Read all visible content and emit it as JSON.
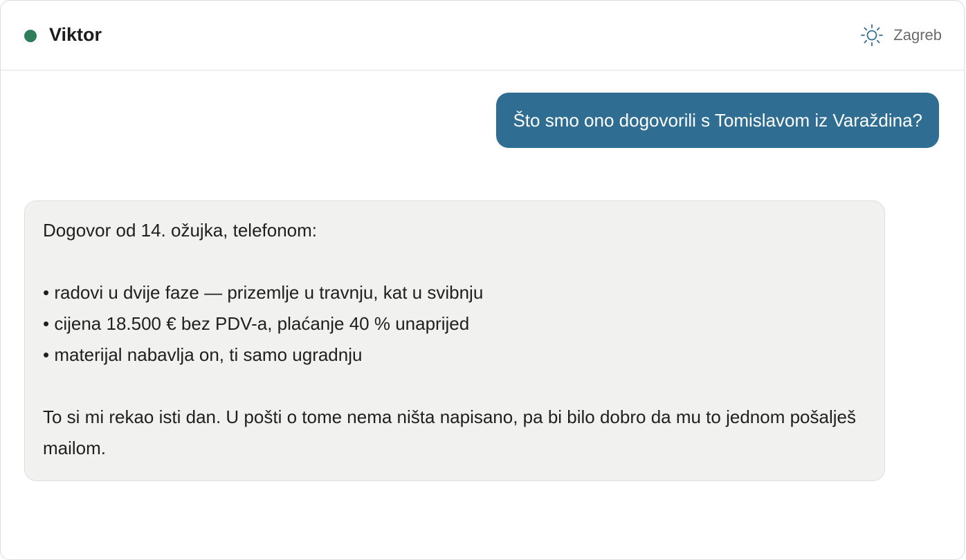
{
  "header": {
    "contact_name": "Viktor",
    "status_color": "#2e7d5b",
    "location_icon": "sun-icon",
    "location_label": "Zagreb",
    "icon_color": "#2f6e92"
  },
  "colors": {
    "outgoing_bubble": "#2f6e92",
    "incoming_bubble": "#f1f1ef"
  },
  "messages": {
    "outgoing": {
      "text": "Što smo ono dogovorili s Tomislavom iz Varaždina?"
    },
    "incoming": {
      "intro": "Dogovor od 14. ožujka, telefonom:",
      "bullets": [
        "• radovi u dvije faze — prizemlje u travnju, kat u svibnju",
        "• cijena 18.500 € bez PDV-a, plaćanje 40 % unaprijed",
        "• materijal nabavlja on, ti samo ugradnju"
      ],
      "closing": "To si mi rekao isti dan. U pošti o tome nema ništa napisano, pa bi bilo dobro da mu to jednom pošalješ mailom."
    }
  }
}
